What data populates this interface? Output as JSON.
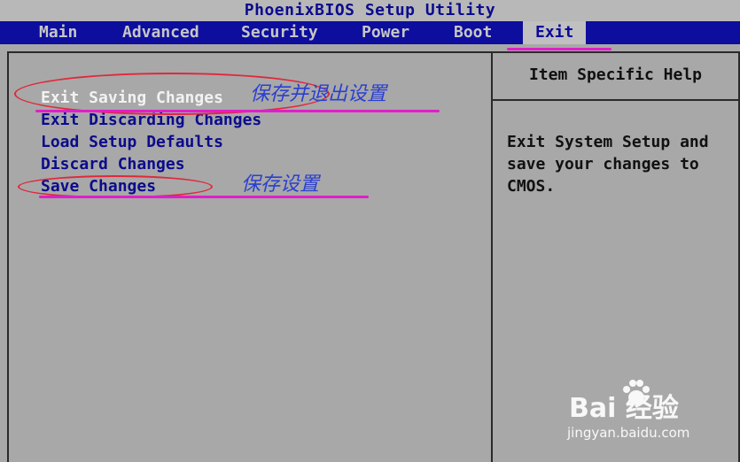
{
  "title": "PhoenixBIOS Setup Utility",
  "menu": [
    {
      "label": "Main"
    },
    {
      "label": "Advanced"
    },
    {
      "label": "Security"
    },
    {
      "label": "Power"
    },
    {
      "label": "Boot"
    },
    {
      "label": "Exit",
      "active": true
    }
  ],
  "options": [
    {
      "label": "Exit Saving Changes",
      "selected": true
    },
    {
      "label": "Exit Discarding Changes"
    },
    {
      "label": "Load Setup Defaults"
    },
    {
      "label": "Discard Changes"
    },
    {
      "label": "Save Changes"
    }
  ],
  "help": {
    "title": "Item Specific Help",
    "text": "Exit System Setup and\nsave your changes to\nCMOS."
  },
  "annotations": {
    "note_save_exit": "保存并退出设置",
    "note_save": "保存设置"
  },
  "watermark": {
    "logo": "Bai  经验",
    "url": "jingyan.baidu.com"
  },
  "colors": {
    "menu_bar": "#0d0d9e",
    "background": "#a8a8a8",
    "option_text": "#0b0b8c",
    "selected_text": "#f2f2f2",
    "annotation_ellipse": "#e0283c",
    "annotation_underline": "#e01ec8",
    "annotation_note": "#2a3fd0"
  }
}
